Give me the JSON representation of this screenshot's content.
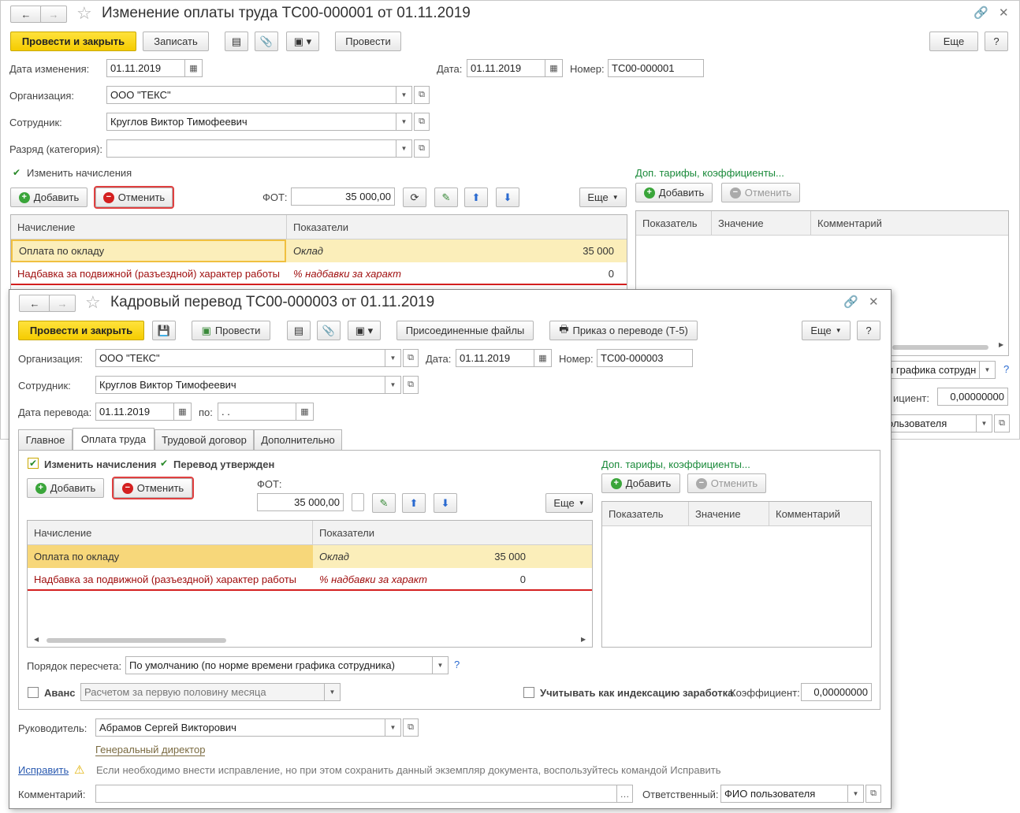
{
  "back_window": {
    "title": "Изменение оплаты труда ТС00-000001 от 01.11.2019",
    "toolbar": {
      "post_close": "Провести и закрыть",
      "save": "Записать",
      "post": "Провести",
      "more": "Еще",
      "help": "?"
    },
    "change_date_label": "Дата изменения:",
    "change_date": "01.11.2019",
    "date_label": "Дата:",
    "date": "01.11.2019",
    "number_label": "Номер:",
    "number": "ТС00-000001",
    "org_label": "Организация:",
    "org": "ООО \"ТЕКС\"",
    "employee_label": "Сотрудник:",
    "employee": "Круглов Виктор Тимофеевич",
    "rank_label": "Разряд (категория):",
    "rank": "",
    "change_accruals": "Изменить начисления",
    "add": "Добавить",
    "cancel": "Отменить",
    "fot_label": "ФОТ:",
    "fot": "35 000,00",
    "more": "Еще",
    "grid": {
      "col_accrual": "Начисление",
      "col_indicators": "Показатели",
      "rows": [
        {
          "accrual": "Оплата по окладу",
          "indicator": "Оклад",
          "value": "35 000"
        },
        {
          "accrual": "Надбавка за подвижной (разъездной) характер работы",
          "indicator": "% надбавки за характ",
          "value": "0"
        }
      ]
    },
    "tariffs_link": "Доп. тарифы, коэффициенты...",
    "t_add": "Добавить",
    "t_cancel": "Отменить",
    "tgrid": {
      "col1": "Показатель",
      "col2": "Значение",
      "col3": "Комментарий"
    },
    "recalc_partial": "и графика сотрудн",
    "coef_label_partial": "ициент:",
    "coef": "0,00000000",
    "resp_partial": "ользователя",
    "help_q": "?"
  },
  "front_window": {
    "title": "Кадровый перевод ТС00-000003 от 01.11.2019",
    "toolbar": {
      "post_close": "Провести и закрыть",
      "post": "Провести",
      "attached": "Присоединенные файлы",
      "order": "Приказ о переводе (Т-5)",
      "more": "Еще",
      "help": "?"
    },
    "org_label": "Организация:",
    "org": "ООО \"ТЕКС\"",
    "date_label": "Дата:",
    "date": "01.11.2019",
    "number_label": "Номер:",
    "number": "ТС00-000003",
    "employee_label": "Сотрудник:",
    "employee": "Круглов Виктор Тимофеевич",
    "transfer_date_label": "Дата перевода:",
    "transfer_date": "01.11.2019",
    "to_label": "по:",
    "to_date": " .  .",
    "tabs": [
      {
        "label": "Главное"
      },
      {
        "label": "Оплата труда"
      },
      {
        "label": "Трудовой договор"
      },
      {
        "label": "Дополнительно"
      }
    ],
    "change_accruals": "Изменить начисления",
    "transfer_approved": "Перевод утвержден",
    "add": "Добавить",
    "cancel": "Отменить",
    "fot_label": "ФОТ:",
    "fot": "35 000,00",
    "more": "Еще",
    "grid": {
      "col_accrual": "Начисление",
      "col_indicators": "Показатели",
      "rows": [
        {
          "accrual": "Оплата по окладу",
          "indicator": "Оклад",
          "value": "35 000"
        },
        {
          "accrual": "Надбавка за подвижной (разъездной) характер работы",
          "indicator": "% надбавки за характ",
          "value": "0"
        }
      ]
    },
    "tariffs_link": "Доп. тарифы, коэффициенты...",
    "t_add": "Добавить",
    "t_cancel": "Отменить",
    "tgrid": {
      "col1": "Показатель",
      "col2": "Значение",
      "col3": "Комментарий"
    },
    "recalc_label": "Порядок пересчета:",
    "recalc": "По умолчанию (по норме времени графика сотрудника)",
    "recalc_help": "?",
    "advance_label": "Аванс",
    "advance": "Расчетом за первую половину месяца",
    "indexation_label": "Учитывать как индексацию заработка",
    "coef_label": "Коэффициент:",
    "coef": "0,00000000",
    "manager_label": "Руководитель:",
    "manager": "Абрамов Сергей Викторович",
    "manager_position": "Генеральный директор",
    "fix_link": "Исправить",
    "fix_hint": "Если необходимо внести исправление, но при этом сохранить данный экземпляр документа, воспользуйтесь командой Исправить",
    "comment_label": "Комментарий:",
    "comment": "",
    "responsible_label": "Ответственный:",
    "responsible": "ФИО пользователя"
  }
}
